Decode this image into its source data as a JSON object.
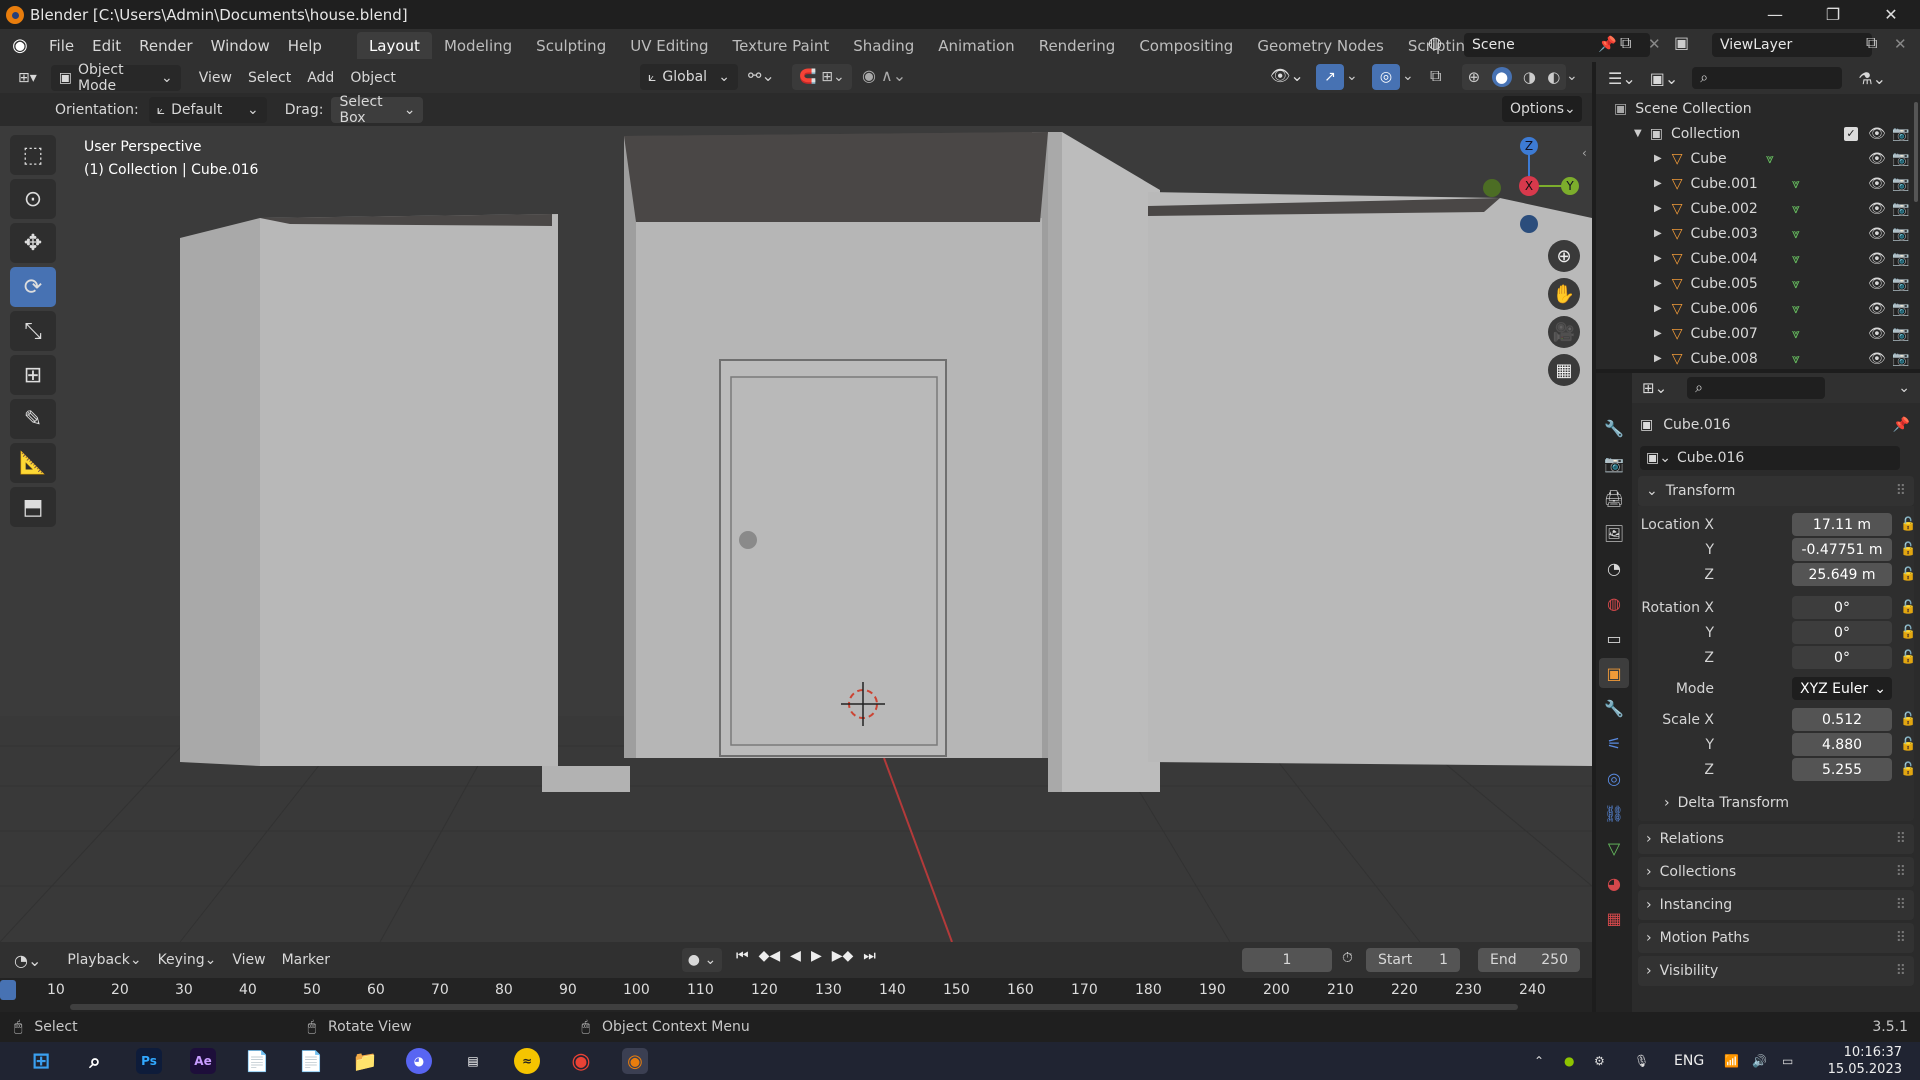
{
  "window": {
    "title": "Blender [C:\\Users\\Admin\\Documents\\house.blend]",
    "minimize": "—",
    "maximize": "❐",
    "close": "✕"
  },
  "menu": {
    "items": [
      "File",
      "Edit",
      "Render",
      "Window",
      "Help"
    ],
    "workspaces": [
      "Layout",
      "Modeling",
      "Sculpting",
      "UV Editing",
      "Texture Paint",
      "Shading",
      "Animation",
      "Rendering",
      "Compositing",
      "Geometry Nodes",
      "Scripting"
    ],
    "active_workspace": "Layout",
    "add_tab": "+",
    "scene": "Scene",
    "view_layer": "ViewLayer"
  },
  "header3d": {
    "mode": "Object Mode",
    "menus": [
      "View",
      "Select",
      "Add",
      "Object"
    ],
    "transform_orientation": "Global"
  },
  "tool_options": {
    "orientation_label": "Orientation:",
    "orientation_value": "Default",
    "drag_label": "Drag:",
    "drag_value": "Select Box",
    "options": "Options"
  },
  "viewport": {
    "perspective": "User Perspective",
    "context": "(1) Collection | Cube.016",
    "gizmo": {
      "x": "X",
      "y": "Y",
      "z": "Z"
    }
  },
  "outliner": {
    "scene_collection": "Scene Collection",
    "collection": "Collection",
    "objects": [
      "Cube",
      "Cube.001",
      "Cube.002",
      "Cube.003",
      "Cube.004",
      "Cube.005",
      "Cube.006",
      "Cube.007",
      "Cube.008"
    ]
  },
  "properties": {
    "object_name": "Cube.016",
    "object_field": "Cube.016",
    "transform_title": "Transform",
    "location_label": "Location X",
    "location": [
      "17.11 m",
      "-0.47751 m",
      "25.649 m"
    ],
    "rotation_label": "Rotation X",
    "rotation": [
      "0°",
      "0°",
      "0°"
    ],
    "mode_label": "Mode",
    "mode_value": "XYZ Euler",
    "scale_label": "Scale X",
    "scale": [
      "0.512",
      "4.880",
      "5.255"
    ],
    "axis_y": "Y",
    "axis_z": "Z",
    "sections": [
      "Delta Transform",
      "Relations",
      "Collections",
      "Instancing",
      "Motion Paths",
      "Visibility"
    ]
  },
  "timeline": {
    "menus": [
      "Playback",
      "Keying",
      "View",
      "Marker"
    ],
    "current_frame": "1",
    "start_label": "Start",
    "start": "1",
    "end_label": "End",
    "end": "250",
    "ticks": [
      "10",
      "20",
      "30",
      "40",
      "50",
      "60",
      "70",
      "80",
      "90",
      "100",
      "110",
      "120",
      "130",
      "140",
      "150",
      "160",
      "170",
      "180",
      "190",
      "200",
      "210",
      "220",
      "230",
      "240"
    ]
  },
  "status": {
    "select": "Select",
    "rotate": "Rotate View",
    "context_menu": "Object Context Menu",
    "version": "3.5.1"
  },
  "taskbar": {
    "lang": "ENG",
    "time": "10:16:37",
    "date": "15.05.2023"
  }
}
